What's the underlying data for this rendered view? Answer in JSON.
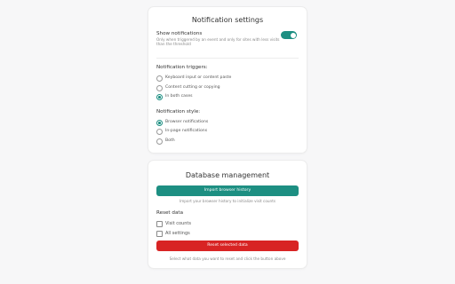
{
  "notification_settings": {
    "title": "Notification settings",
    "show_notifications": {
      "label": "Show notifications",
      "description": "Only when triggered by an event and only for sites with less visits than the threshold",
      "enabled": true
    },
    "triggers": {
      "label": "Notification triggers:",
      "options": [
        "Keyboard input or content paste",
        "Content cutting or copying",
        "In both cases"
      ],
      "selected": "In both cases"
    },
    "style": {
      "label": "Notification style:",
      "options": [
        "Browser notifications",
        "In-page notifications",
        "Both"
      ],
      "selected": "Browser notifications"
    }
  },
  "database_management": {
    "title": "Database management",
    "import_button": "Import browser history",
    "import_hint": "Import your browser history to initialize visit counts",
    "reset_label": "Reset data",
    "reset_options": [
      {
        "label": "Visit counts",
        "checked": false
      },
      {
        "label": "All settings",
        "checked": false
      }
    ],
    "reset_button": "Reset selected data",
    "reset_hint": "Select what data you want to reset and click the button above"
  },
  "colors": {
    "accent": "#1d8f82",
    "danger": "#d82424"
  }
}
